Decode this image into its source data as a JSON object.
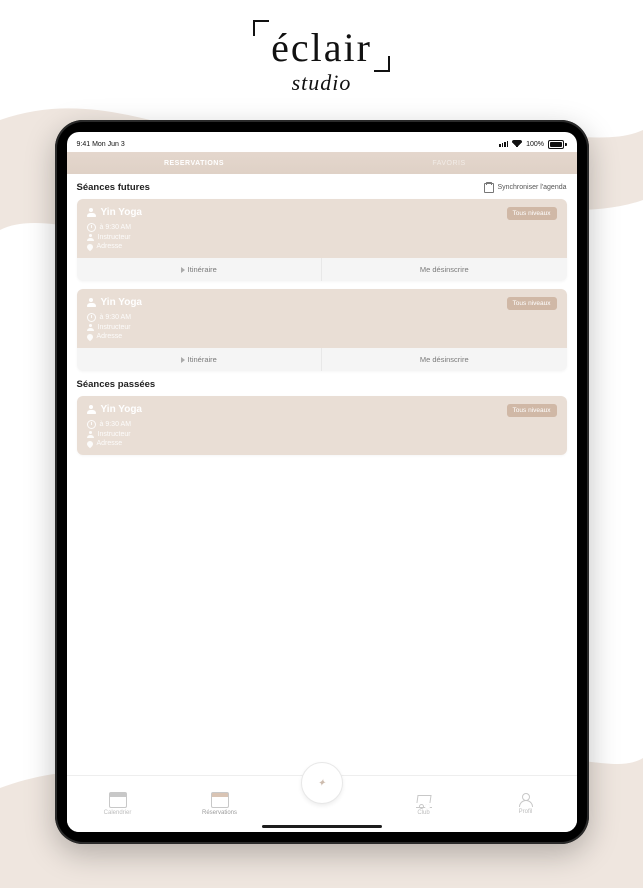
{
  "brand": {
    "top": "éclair",
    "sub": "studio"
  },
  "status": {
    "left": "9:41 Mon Jun 3",
    "battery": "100%"
  },
  "topTabs": {
    "active": "RESERVATIONS",
    "inactive": "FAVORIS"
  },
  "sync": {
    "label": "Synchroniser l'agenda"
  },
  "sections": {
    "future": "Séances futures",
    "past": "Séances passées"
  },
  "badge": "Tous niveaux",
  "actions": {
    "route": "Itinéraire",
    "unreg": "Me désinscrire"
  },
  "sessions": {
    "future": [
      {
        "title": "Yin Yoga",
        "time": "à 9:30 AM",
        "instructor": "Instructeur",
        "place": "Adresse"
      },
      {
        "title": "Yin Yoga",
        "time": "à 9:30 AM",
        "instructor": "Instructeur",
        "place": "Adresse"
      }
    ],
    "past": [
      {
        "title": "Yin Yoga",
        "time": "à 9:30 AM",
        "instructor": "Instructeur",
        "place": "Adresse"
      }
    ]
  },
  "nav": {
    "calendar": "Calendrier",
    "reservations": "Réservations",
    "center": "logo",
    "club": "Club",
    "profile": "Profil"
  }
}
